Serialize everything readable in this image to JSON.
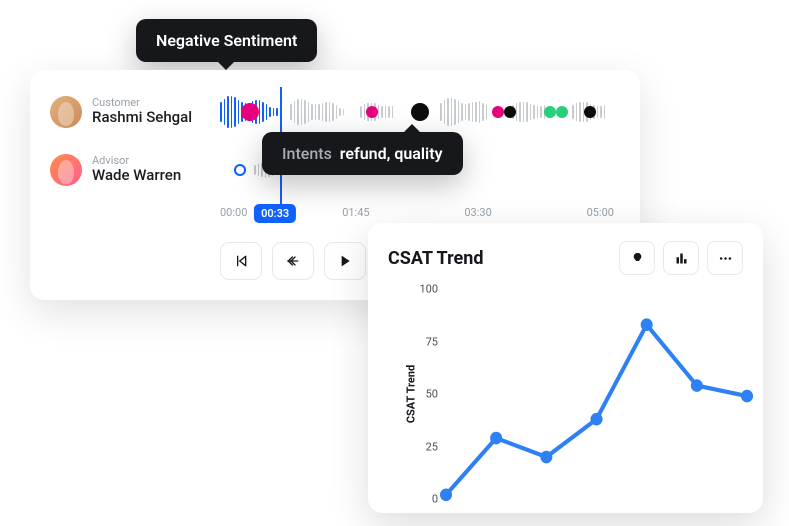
{
  "tooltip_sentiment": "Negative Sentiment",
  "tooltip_intents_label": "Intents",
  "tooltip_intents_value": "refund, quality",
  "customer": {
    "role": "Customer",
    "name": "Rashmi Sehgal"
  },
  "advisor": {
    "role": "Advisor",
    "name": "Wade Warren"
  },
  "timeline": {
    "ticks": [
      "00:00",
      "01:45",
      "03:30",
      "05:00"
    ],
    "current": "00:33",
    "current_pos_pct": 14
  },
  "csat": {
    "title": "CSAT Trend",
    "axis_title": "CSAT Trend"
  },
  "chart_data": {
    "type": "line",
    "title": "CSAT Trend",
    "ylabel": "CSAT Trend",
    "xlabel": "",
    "ylim": [
      0,
      100
    ],
    "y_ticks": [
      0,
      25,
      50,
      75,
      100
    ],
    "x": [
      0,
      1,
      2,
      3,
      4,
      5,
      6
    ],
    "values": [
      2,
      29,
      20,
      38,
      83,
      54,
      49
    ]
  }
}
